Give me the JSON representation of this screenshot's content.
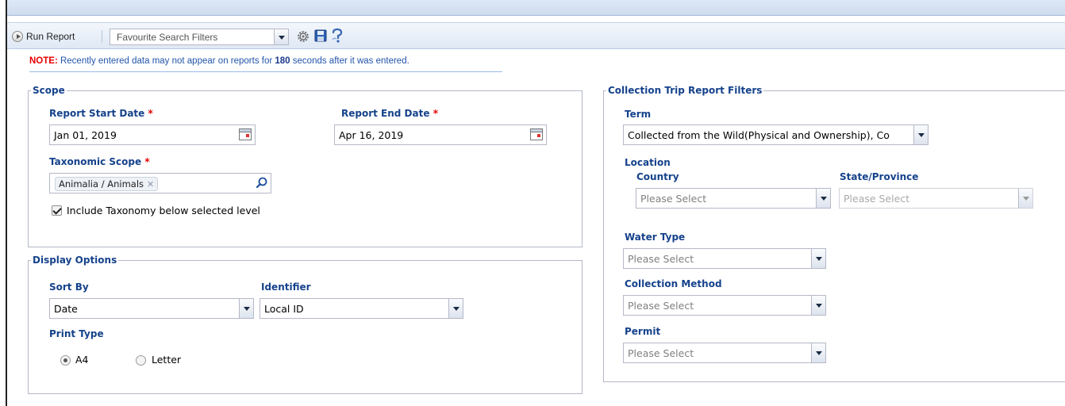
{
  "toolbar": {
    "run_report_label": "Run Report",
    "favourite_filters_value": "Favourite Search Filters",
    "icons": [
      "play-icon",
      "gear-icon",
      "save-icon",
      "help-icon"
    ]
  },
  "note": {
    "label": "NOTE:",
    "text_before": " Recently entered data may not appear on reports for ",
    "seconds": "180",
    "text_after": " seconds after it was entered."
  },
  "scope": {
    "legend": "Scope",
    "start_date_label": "Report Start Date",
    "start_date_value": "Jan 01, 2019",
    "end_date_label": "Report End Date",
    "end_date_value": "Apr 16, 2019",
    "taxonomic_scope_label": "Taxonomic Scope",
    "taxonomic_tag": "Animalia / Animals",
    "include_taxonomy_label": "Include Taxonomy below selected level",
    "include_taxonomy_checked": true,
    "required_marker": "*"
  },
  "display": {
    "legend": "Display Options",
    "sort_by_label": "Sort By",
    "sort_by_value": "Date",
    "identifier_label": "Identifier",
    "identifier_value": "Local ID",
    "print_type_label": "Print Type",
    "print_options": [
      {
        "label": "A4",
        "selected": true
      },
      {
        "label": "Letter",
        "selected": false
      }
    ]
  },
  "collection": {
    "legend": "Collection Trip Report Filters",
    "term_label": "Term",
    "term_value": "Collected from the Wild(Physical and Ownership), Co",
    "location_label": "Location",
    "country_label": "Country",
    "country_value": "Please Select",
    "state_label": "State/Province",
    "state_value": "Please Select",
    "water_type_label": "Water Type",
    "water_type_value": "Please Select",
    "collection_method_label": "Collection Method",
    "collection_method_value": "Please Select",
    "permit_label": "Permit",
    "permit_value": "Please Select"
  }
}
